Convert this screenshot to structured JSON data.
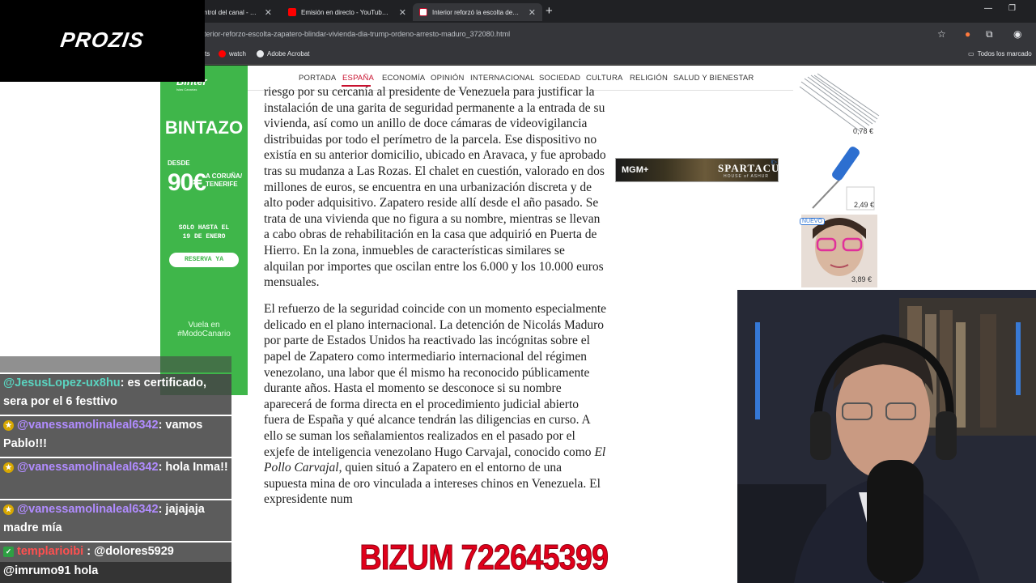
{
  "browser": {
    "tabs": [
      {
        "label": "ntrol del canal - Yo",
        "fav_color": "#e8eaed"
      },
      {
        "label": "Emisión en directo - YouTube S",
        "fav_color": "#ff0000"
      },
      {
        "label": "Interior reforzó la escolta de Za",
        "fav_color": "#c8102e"
      }
    ],
    "tab_close": "✕",
    "new_tab": "+",
    "window_controls": {
      "minimize": "—",
      "restore": "❐",
      "close": "✕"
    },
    "url": "terior-reforzo-escolta-zapatero-blindar-vivienda-dia-trump-ordeno-arresto-maduro_372080.html",
    "bookmarks": [
      {
        "label": "ts"
      },
      {
        "label": "watch",
        "color": "#ff0000"
      },
      {
        "label": "Adobe Acrobat",
        "color": "#e8eaed"
      }
    ],
    "all_bookmarks": "Todos los marcado"
  },
  "overlay": {
    "brand": "PROZIS",
    "bizum": "BIZUM 722645399"
  },
  "ad_binter": {
    "logo": "Binter",
    "logo_sub": "Islas Canarias",
    "headline": "BINTAZO",
    "desde": "DESDE",
    "price": "90€",
    "destination_1": "A CORUÑA/",
    "destination_2": "TENERIFE",
    "promo_1": "SOLO HASTA EL",
    "promo_2": "19 DE ENERO",
    "cta": "RESERVA YA",
    "tagline_1": "Vuela en",
    "tagline_2": "#ModoCanario"
  },
  "site_nav": {
    "items": [
      "PORTADA",
      "ESPAÑA",
      "ECONOMÍA",
      "OPINIÓN",
      "INTERNACIONAL",
      "SOCIEDAD",
      "CULTURA",
      "RELIGIÓN",
      "SALUD Y BIENESTAR"
    ],
    "active": "ESPAÑA"
  },
  "article": {
    "paragraph_1": "riesgo por su cercanía al presidente de Venezuela para justificar la instalación de una garita de seguridad permanente a la entrada de su vivienda, así como un anillo de doce cámaras de videovigilancia distribuidas por todo el perímetro de la parcela. Ese dispositivo no existía en su anterior domicilio, ubicado en Aravaca, y fue aprobado tras su mudanza a Las Rozas. El chalet en cuestión, valorado en dos millones de euros, se encuentra en una urbanización discreta y de alto poder adquisitivo. Zapatero reside allí desde el año pasado. Se trata de una vivienda que no figura a su nombre, mientras se llevan a cabo obras de rehabilitación en la casa que adquirió en Puerta de Hierro. En la zona, inmuebles de características similares se alquilan por importes que oscilan entre los 6.000 y los 10.000 euros mensuales.",
    "paragraph_2_a": "El refuerzo de la seguridad coincide con un momento especialmente delicado en el plano internacional. La detención de Nicolás Maduro por parte de Estados Unidos ha reactivado las incógnitas sobre el papel de Zapatero como intermediario internacional del régimen venezolano, una labor que él mismo ha reconocido públicamente durante años. Hasta el momento se desconoce si su nombre aparecerá de forma directa en el procedimiento judicial abierto fuera de España y qué alcance tendrán las diligencias en curso. A ello se suman los señalamientos realizados en el pasado por el exjefe de inteligencia venezolano Hugo Carvajal, conocido como ",
    "paragraph_2_em": "El Pollo Carvajal",
    "paragraph_2_b": ", quien situó a Zapatero en el entorno de una supuesta mina de oro vinculada a intereses chinos en Venezuela. El expresidente num"
  },
  "ad_mgm": {
    "brand": "MGM+",
    "title": "SPARTACUS",
    "subtitle": "HOUSE of ASHUR",
    "info": "i▷"
  },
  "ad_products": [
    {
      "price": "0,78 €"
    },
    {
      "price": "2,49 €"
    },
    {
      "price": "3,89 €",
      "badge": "NUEVO"
    }
  ],
  "chat": {
    "messages": [
      {
        "user": "@JesusLopez-ux8hu",
        "text": ": es certificado, sera por el 6 festtivo",
        "badge": ""
      },
      {
        "user": "@vanessamolinaleal6342",
        "text": ": vamos Pablo!!!",
        "badge": "★"
      },
      {
        "user": "@vanessamolinaleal6342",
        "text": ": hola Inma!!",
        "badge": "★"
      },
      {
        "user": "@vanessamolinaleal6342",
        "text": ": jajajaja madre mía",
        "badge": "★"
      },
      {
        "user": "templarioibi",
        "text": ": @dolores5929",
        "badge": "✓"
      },
      {
        "user": "",
        "text": "@imrumo91 hola",
        "badge": ""
      }
    ]
  }
}
